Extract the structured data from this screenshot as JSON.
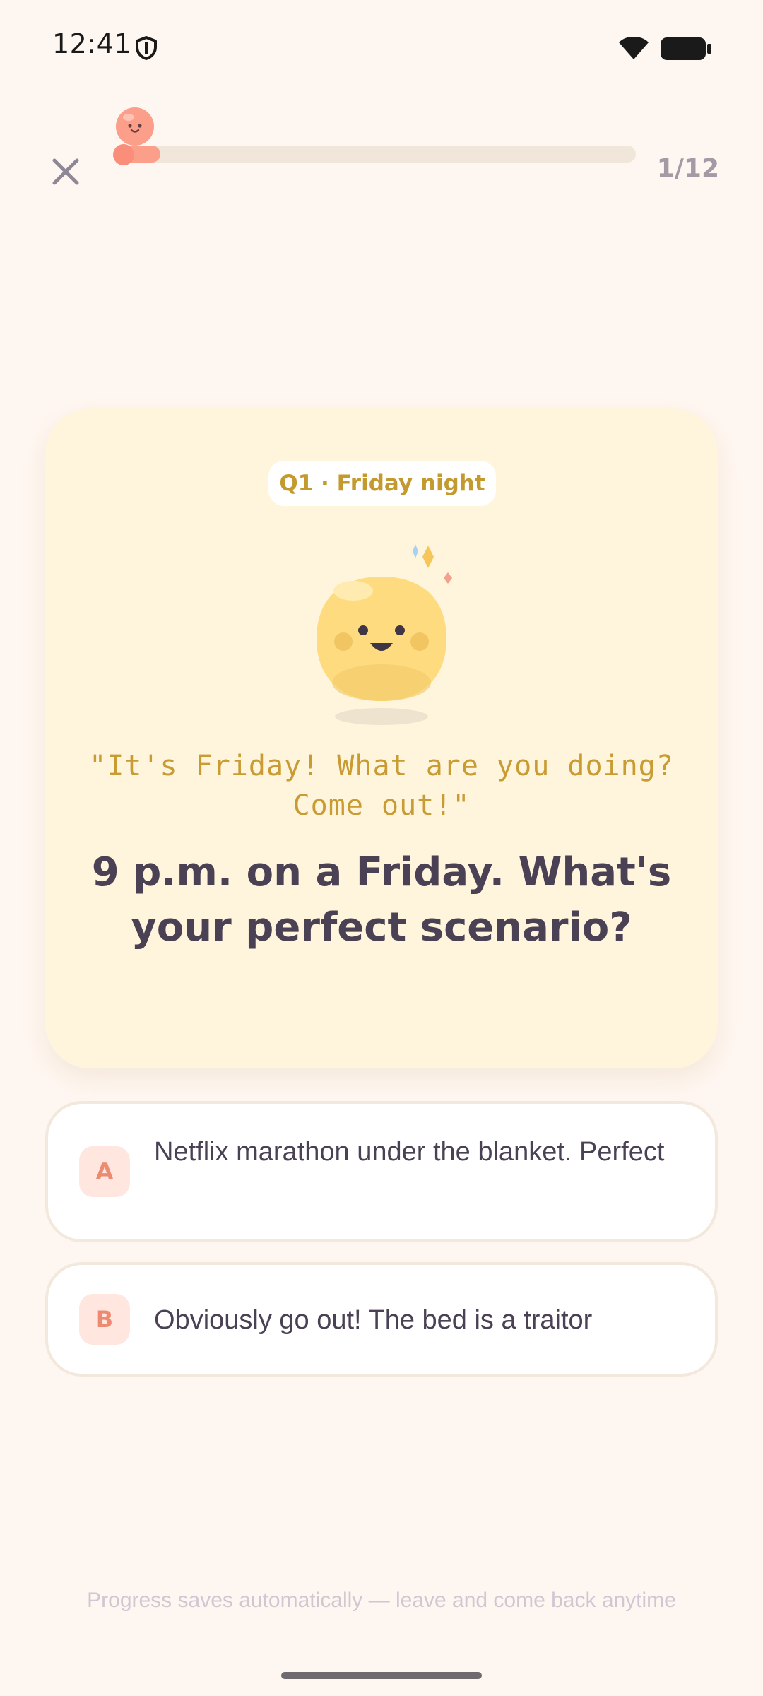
{
  "status_bar": {
    "time": "12:41"
  },
  "header": {
    "progress_label": "1/12",
    "progress_fraction": 0.083
  },
  "question": {
    "tag": "Q1 · Friday night",
    "speech": "\"It's Friday! What are you doing? Come out!\"",
    "text": "9 p.m. on a Friday. What's your perfect scenario?"
  },
  "options": [
    {
      "letter": "A",
      "text": "Netflix marathon under the blanket. Perfect"
    },
    {
      "letter": "B",
      "text": "Obviously go out! The bed is a traitor"
    }
  ],
  "footer": {
    "note": "Progress saves automatically — leave and come back anytime"
  },
  "colors": {
    "background": "#FEF6F0",
    "card": "#FFF5DC",
    "accent": "#FB9E8A",
    "text_dark": "#4A4154",
    "quote_gold": "#C89B33"
  },
  "icons": {
    "status": [
      "shield-icon",
      "wifi-icon",
      "battery-icon"
    ],
    "close": "close-icon",
    "mascot": "smiling-blob-mascot"
  }
}
